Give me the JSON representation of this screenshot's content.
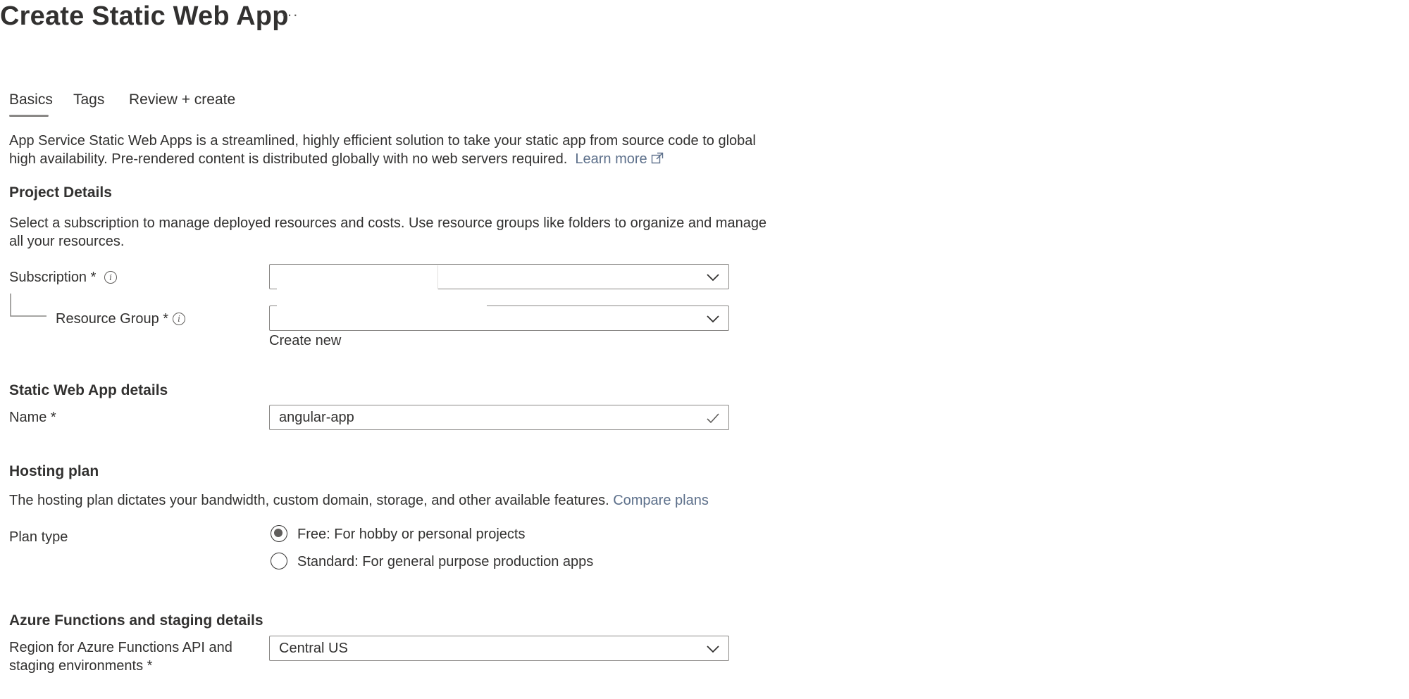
{
  "header": {
    "title": "Create Static Web App",
    "more_label": "···"
  },
  "tabs": [
    {
      "label": "Basics",
      "active": true
    },
    {
      "label": "Tags",
      "active": false
    },
    {
      "label": "Review + create",
      "active": false
    }
  ],
  "intro": {
    "text_line1": "App Service Static Web Apps is a streamlined, highly efficient solution to take your static app from source code to global",
    "text_line2": "high availability. Pre-rendered content is distributed globally with no web servers required.",
    "learn_more": "Learn more"
  },
  "project_details": {
    "heading": "Project Details",
    "desc_line1": "Select a subscription to manage deployed resources and costs. Use resource groups like folders to organize and manage",
    "desc_line2": "all your resources.",
    "subscription_label": "Subscription *",
    "subscription_value": "",
    "resource_group_label": "Resource Group *",
    "resource_group_value": "",
    "create_new": "Create new"
  },
  "app_details": {
    "heading": "Static Web App details",
    "name_label": "Name *",
    "name_value": "angular-app"
  },
  "hosting": {
    "heading": "Hosting plan",
    "desc": "The hosting plan dictates your bandwidth, custom domain, storage, and other available features.",
    "compare_plans": "Compare plans",
    "plan_type_label": "Plan type",
    "options": [
      {
        "label": "Free: For hobby or personal projects",
        "selected": true
      },
      {
        "label": "Standard: For general purpose production apps",
        "selected": false
      }
    ]
  },
  "functions": {
    "heading": "Azure Functions and staging details",
    "region_label_line1": "Region for Azure Functions API and",
    "region_label_line2": "staging environments *",
    "region_value": "Central US"
  },
  "colors": {
    "link": "#5c6f8a",
    "text": "#323130",
    "border": "#8a8886"
  }
}
